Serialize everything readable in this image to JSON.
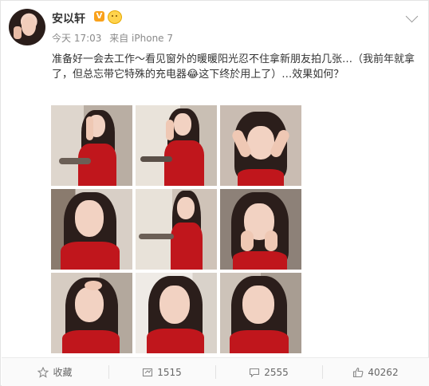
{
  "user": {
    "name": "安以轩",
    "verified_badge": "V"
  },
  "meta": {
    "time": "今天 17:03",
    "source": "来自 iPhone 7"
  },
  "post": {
    "text": "准备好一会去工作～看见窗外的暖暖阳光忍不住拿新朋友拍几张…（我前年就拿了，但总忘带它特殊的充电器😂这下终於用上了）…效果如何？"
  },
  "photos": [
    {
      "label": "photo-1"
    },
    {
      "label": "photo-2"
    },
    {
      "label": "photo-3"
    },
    {
      "label": "photo-4"
    },
    {
      "label": "photo-5"
    },
    {
      "label": "photo-6"
    },
    {
      "label": "photo-7"
    },
    {
      "label": "photo-8"
    },
    {
      "label": "photo-9"
    }
  ],
  "actions": {
    "favorite": {
      "label": "收藏",
      "icon": "star-icon"
    },
    "repost": {
      "label": "1515",
      "icon": "repost-icon"
    },
    "comment": {
      "label": "2555",
      "icon": "comment-icon"
    },
    "like": {
      "label": "40262",
      "icon": "thumbs-up-icon"
    }
  },
  "colors": {
    "dress_red": "#c0161c",
    "badge": "#f9a11b",
    "text": "#333333",
    "meta": "#8a8a8a"
  }
}
